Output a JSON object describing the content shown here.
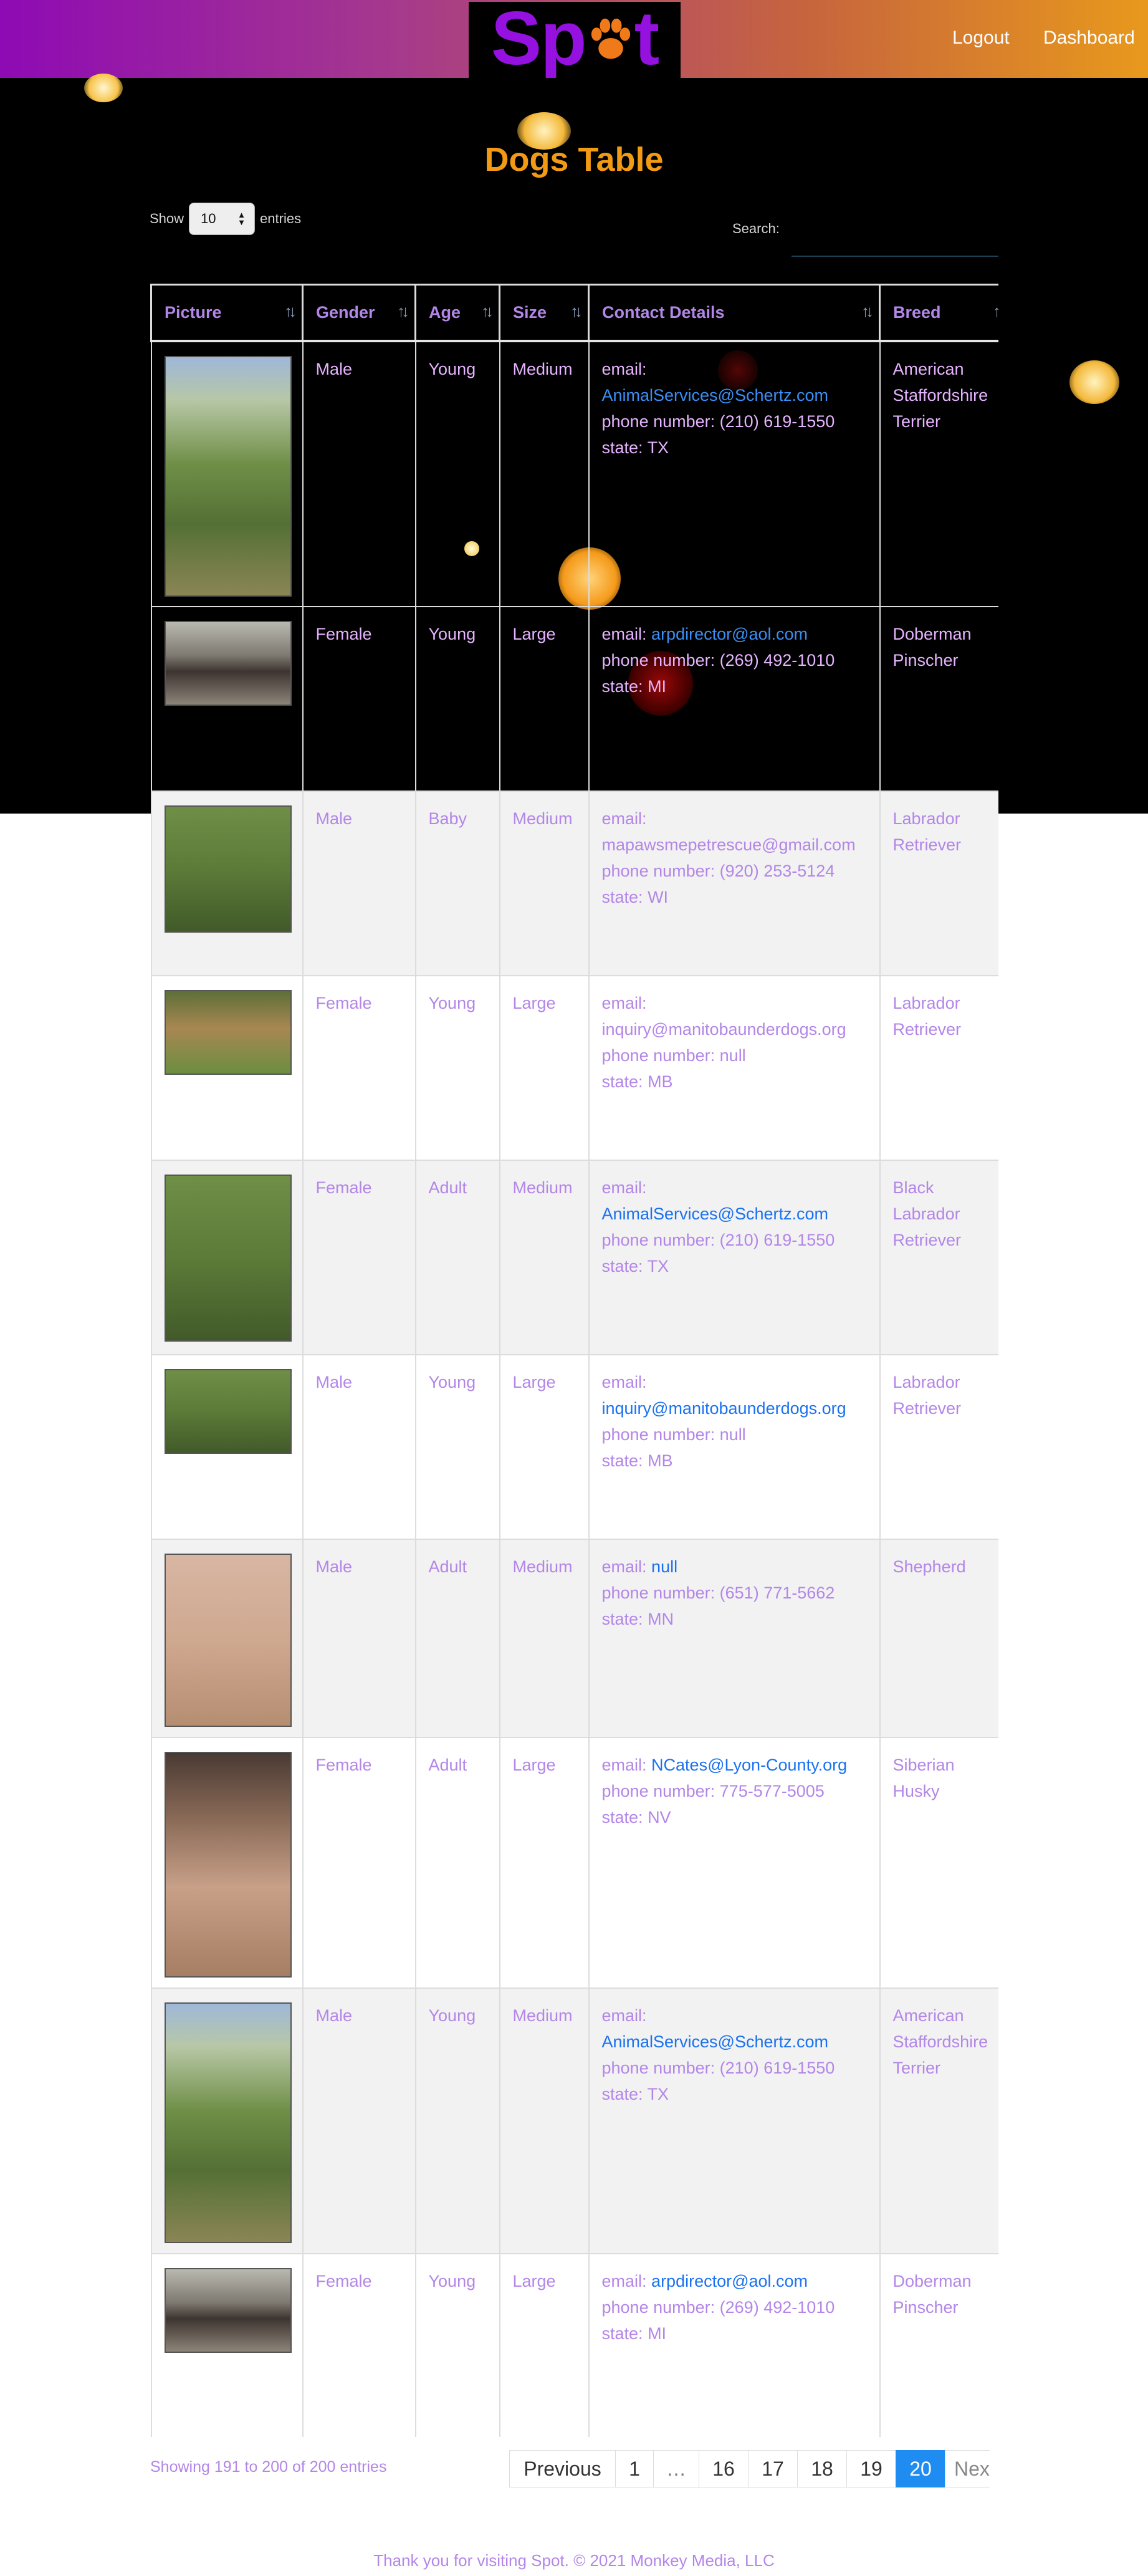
{
  "brand": {
    "logo_text": "Spot"
  },
  "nav": {
    "logout": "Logout",
    "dashboard": "Dashboard"
  },
  "page_title": "Dogs Table",
  "length_control": {
    "show": "Show",
    "value": "10",
    "entries": "entries"
  },
  "search": {
    "label": "Search:",
    "value": ""
  },
  "table": {
    "columns": [
      "Picture",
      "Gender",
      "Age",
      "Size",
      "Contact Details",
      "Breed"
    ],
    "contact_labels": {
      "email": "email:",
      "phone": "phone number:",
      "state": "state:"
    },
    "rows": [
      {
        "gender": "Male",
        "age": "Young",
        "size": "Medium",
        "email": "AnimalServices@Schertz.com",
        "phone": "(210) 619-1550",
        "state": "TX",
        "breed": "American Staffordshire Terrier",
        "photo": "dog-photo"
      },
      {
        "gender": "Female",
        "age": "Young",
        "size": "Large",
        "email": "arpdirector@aol.com",
        "phone": "(269) 492-1010",
        "state": "MI",
        "breed": "Doberman Pinscher",
        "photo": "dog-photo"
      },
      {
        "gender": "Male",
        "age": "Baby",
        "size": "Medium",
        "email": "mapawsmepetrescue@gmail.com",
        "phone": "(920) 253-5124",
        "state": "WI",
        "breed": "Labrador Retriever",
        "photo": "dog-photo"
      },
      {
        "gender": "Female",
        "age": "Young",
        "size": "Large",
        "email": "inquiry@manitobaunderdogs.org",
        "phone": "null",
        "state": "MB",
        "breed": "Labrador Retriever",
        "photo": "dog-photo"
      },
      {
        "gender": "Female",
        "age": "Adult",
        "size": "Medium",
        "email": "AnimalServices@Schertz.com",
        "phone": "(210) 619-1550",
        "state": "TX",
        "breed": "Black Labrador Retriever",
        "photo": "dog-photo"
      },
      {
        "gender": "Male",
        "age": "Young",
        "size": "Large",
        "email": "inquiry@manitobaunderdogs.org",
        "phone": "null",
        "state": "MB",
        "breed": "Labrador Retriever",
        "photo": "dog-photo"
      },
      {
        "gender": "Male",
        "age": "Adult",
        "size": "Medium",
        "email": "null",
        "phone": "(651) 771-5662",
        "state": "MN",
        "breed": "Shepherd",
        "photo": "dog-photo"
      },
      {
        "gender": "Female",
        "age": "Adult",
        "size": "Large",
        "email": "NCates@Lyon-County.org",
        "phone": "775-577-5005",
        "state": "NV",
        "breed": "Siberian Husky",
        "photo": "dog-photo"
      },
      {
        "gender": "Male",
        "age": "Young",
        "size": "Medium",
        "email": "AnimalServices@Schertz.com",
        "phone": "(210) 619-1550",
        "state": "TX",
        "breed": "American Staffordshire Terrier",
        "photo": "dog-photo"
      },
      {
        "gender": "Female",
        "age": "Young",
        "size": "Large",
        "email": "arpdirector@aol.com",
        "phone": "(269) 492-1010",
        "state": "MI",
        "breed": "Doberman Pinscher",
        "photo": "dog-photo"
      }
    ]
  },
  "info": "Showing 191 to 200 of 200 entries",
  "pagination": {
    "previous": "Previous",
    "pages": [
      "1",
      "…",
      "16",
      "17",
      "18",
      "19",
      "20"
    ],
    "active": "20",
    "next": "Nex"
  },
  "footer": "Thank you for visiting Spot. © 2021 Monkey Media, LLC",
  "colors": {
    "accent": "#f29a14",
    "brand_purple": "#9411e0",
    "text_purple": "#b386e8",
    "link": "#1a72f0",
    "active_page": "#1f8cf2"
  }
}
